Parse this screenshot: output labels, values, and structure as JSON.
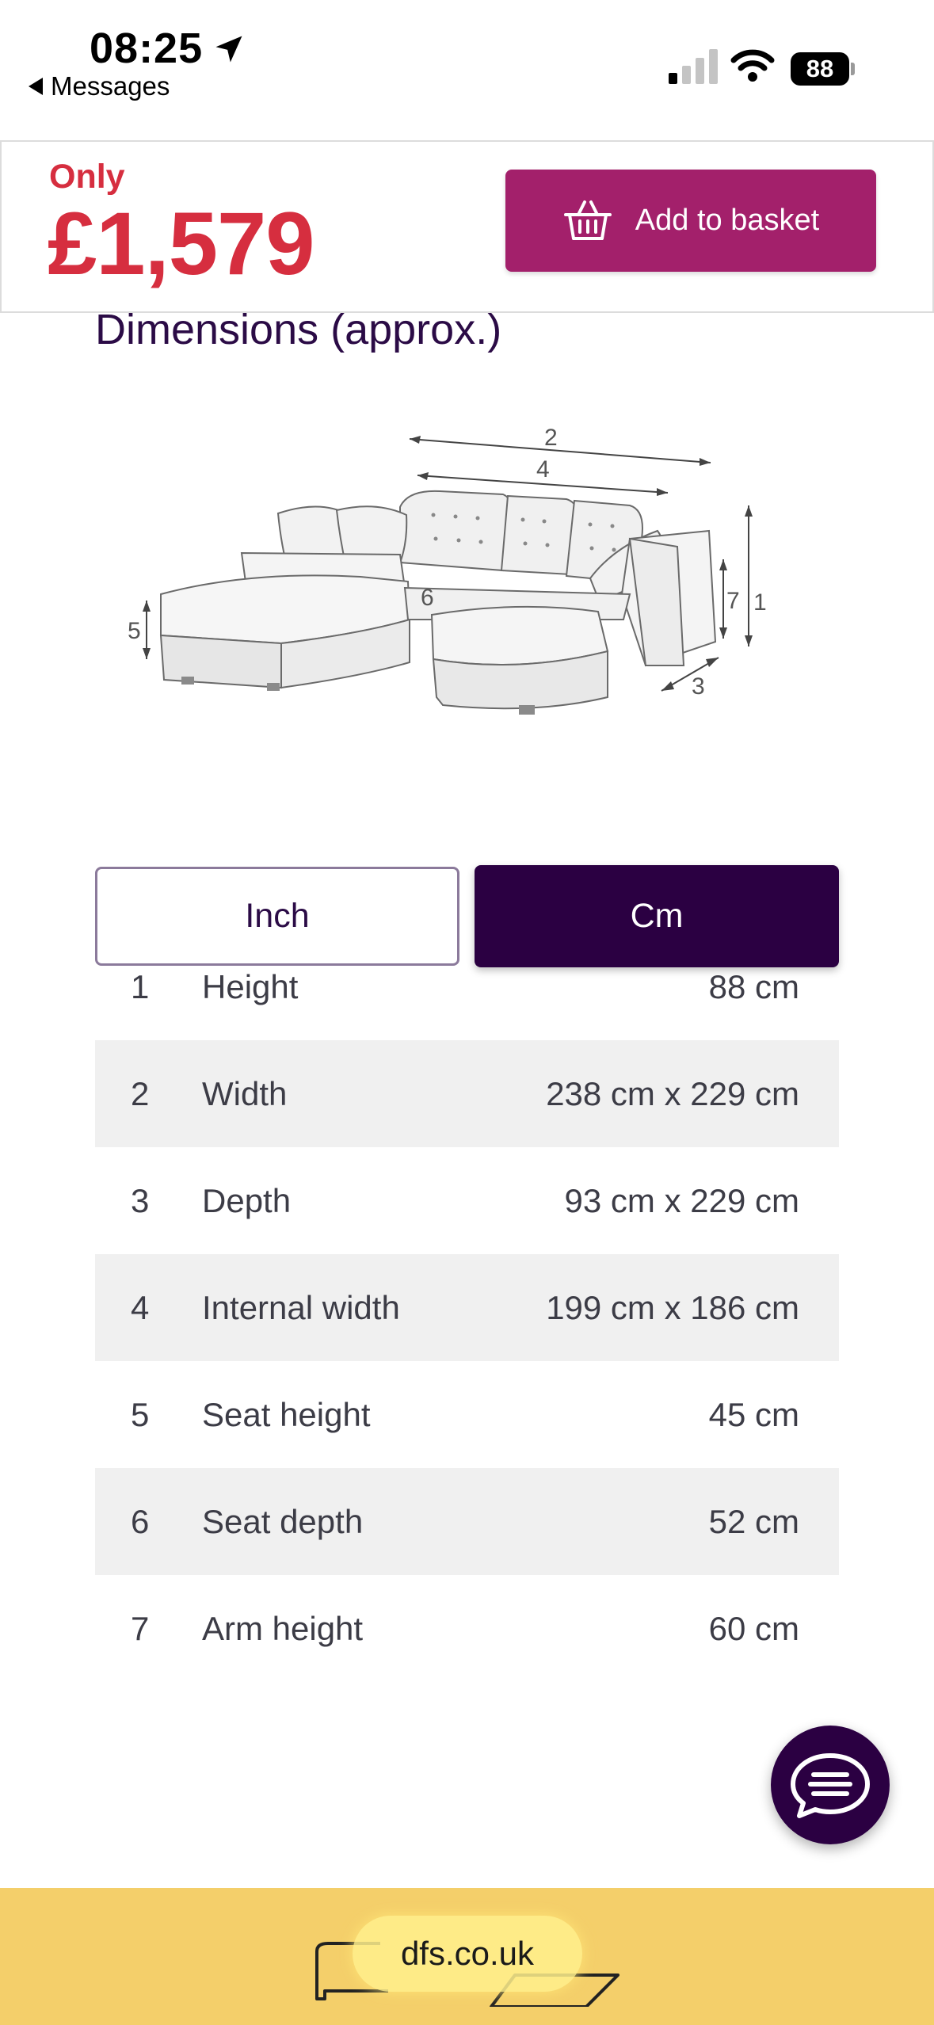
{
  "status_bar": {
    "time": "08:25",
    "back_label": "Messages",
    "battery": "88"
  },
  "price_bar": {
    "only_label": "Only",
    "price": "£1,579",
    "add_to_basket_label": "Add to basket"
  },
  "dimensions": {
    "heading": "Dimensions (approx.)",
    "diagram_labels": [
      "1",
      "2",
      "3",
      "4",
      "5",
      "6",
      "7"
    ],
    "units": {
      "inch_label": "Inch",
      "cm_label": "Cm",
      "selected": "Cm"
    },
    "rows": [
      {
        "num": "1",
        "label": "Height",
        "value": "88 cm"
      },
      {
        "num": "2",
        "label": "Width",
        "value": "238 cm x 229 cm"
      },
      {
        "num": "3",
        "label": "Depth",
        "value": "93 cm x 229 cm"
      },
      {
        "num": "4",
        "label": "Internal width",
        "value": "199 cm x 186 cm"
      },
      {
        "num": "5",
        "label": "Seat height",
        "value": "45 cm"
      },
      {
        "num": "6",
        "label": "Seat depth",
        "value": "52 cm"
      },
      {
        "num": "7",
        "label": "Arm height",
        "value": "60 cm"
      }
    ]
  },
  "address_bar": {
    "url": "dfs.co.uk"
  },
  "colors": {
    "price_red": "#d62e3f",
    "basket_magenta": "#a3206b",
    "brand_purple": "#2b0042",
    "address_bar_yellow": "#f4cf6a"
  },
  "icons": [
    "location-arrow-icon",
    "back-triangle-icon",
    "signal-icon",
    "wifi-icon",
    "battery-icon",
    "basket-icon",
    "chat-icon"
  ]
}
